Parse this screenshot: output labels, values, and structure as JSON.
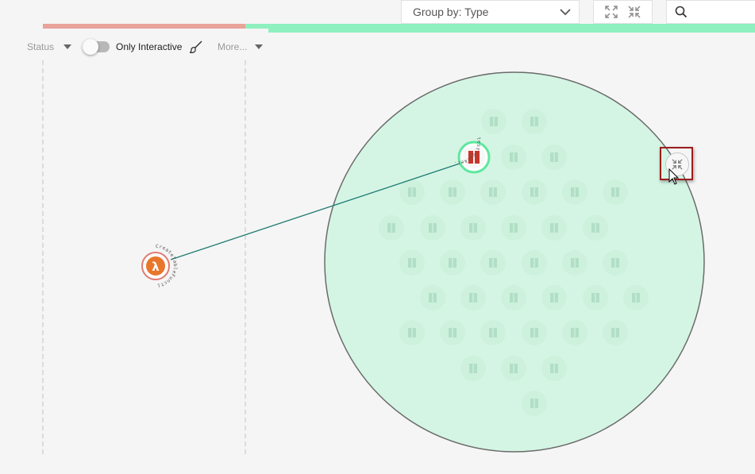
{
  "header": {
    "group_by_label": "Group by: Type",
    "search_placeholder": ""
  },
  "toolbar": {
    "status_label": "Status",
    "only_interactive_label": "Only Interactive",
    "only_interactive_on": false,
    "more_label": "More..."
  },
  "graph": {
    "lambda_node": {
      "label": "CreateTableFunction",
      "icon": "lambda-icon",
      "color": "#e8762c"
    },
    "s3_node": {
      "label": "test-bucket-1",
      "icon": "s3-bucket-icon",
      "color": "#c7352b"
    },
    "cluster_color": "#d4f5e4",
    "edge_color": "#1d7a73"
  },
  "icons": {
    "collapse": "collapse-arrows-icon",
    "expand": "expand-arrows-icon",
    "search": "search-icon",
    "dropdown": "chevron-down-icon"
  }
}
